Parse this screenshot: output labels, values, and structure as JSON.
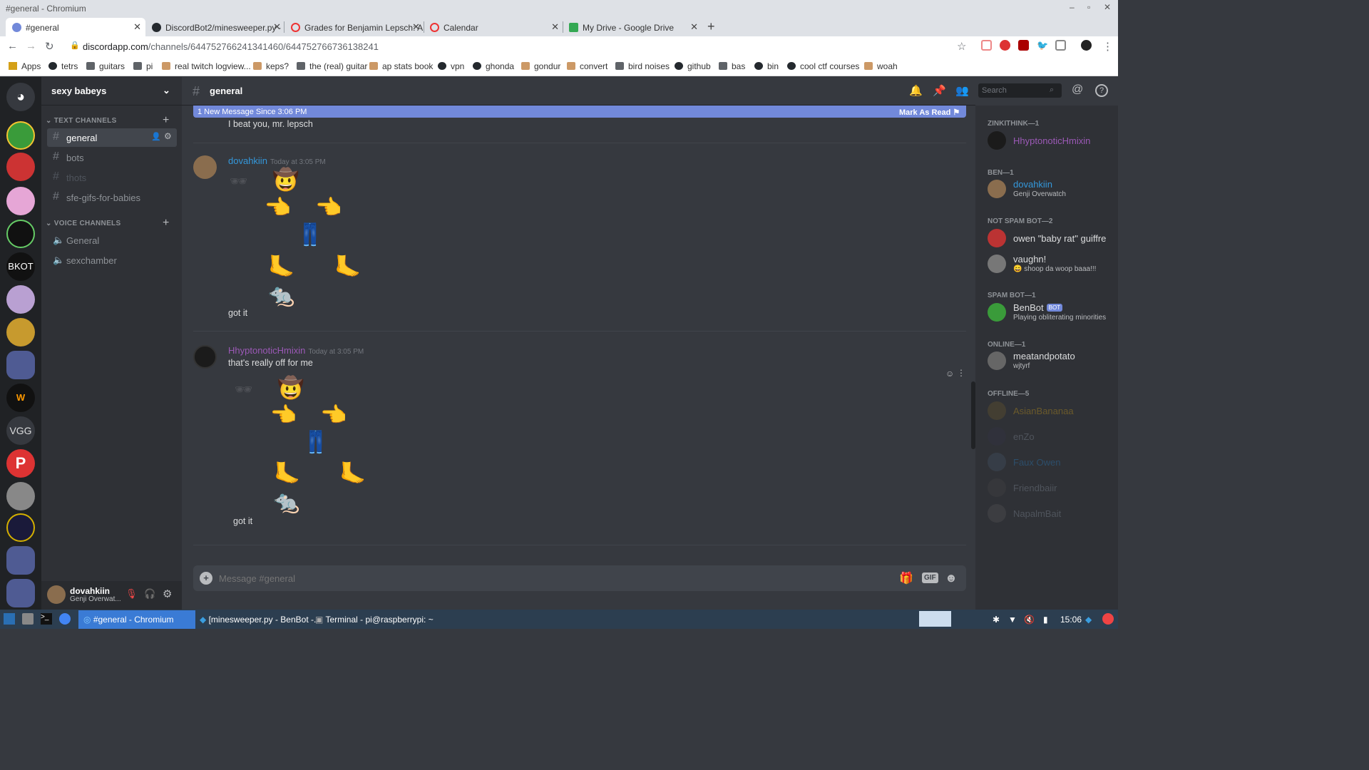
{
  "window": {
    "title": "#general - Chromium"
  },
  "tabs": [
    {
      "label": "#general",
      "color": "#7289da"
    },
    {
      "label": "DiscordBot2/minesweeper.py · ",
      "color": "#24292e"
    },
    {
      "label": "Grades for Benjamin Lepsch: A",
      "color": "#e33"
    },
    {
      "label": "Calendar",
      "color": "#e33"
    },
    {
      "label": "My Drive - Google Drive",
      "color": "#34a853"
    }
  ],
  "url": {
    "host": "discordapp.com",
    "path": "/channels/644752766241341460/644752766736138241"
  },
  "bookmarks": [
    {
      "label": "Apps",
      "icon": "apps-icon"
    },
    {
      "label": "tetrs",
      "icon": "globe-icon"
    },
    {
      "label": "guitars",
      "icon": "folder-icon"
    },
    {
      "label": "pi",
      "icon": "folder-icon"
    },
    {
      "label": "real twitch logview...",
      "icon": "bookmark-icon"
    },
    {
      "label": "keps?",
      "icon": "bookmark-icon"
    },
    {
      "label": "the (real) guitar",
      "icon": "folder-icon"
    },
    {
      "label": "ap stats book",
      "icon": "bookmark-icon"
    },
    {
      "label": "vpn",
      "icon": "github-icon"
    },
    {
      "label": "ghonda",
      "icon": "globe-icon"
    },
    {
      "label": "gondur",
      "icon": "bookmark-icon"
    },
    {
      "label": "convert",
      "icon": "bookmark-icon"
    },
    {
      "label": "bird noises",
      "icon": "folder-icon"
    },
    {
      "label": "github",
      "icon": "github-icon"
    },
    {
      "label": "bas",
      "icon": "folder-icon"
    },
    {
      "label": "bin",
      "icon": "globe-icon"
    },
    {
      "label": "cool ctf courses",
      "icon": "globe-icon"
    },
    {
      "label": "woah",
      "icon": "bookmark-icon"
    }
  ],
  "server": {
    "name": "sexy babeys",
    "vgg": "VGG"
  },
  "sidebar": {
    "text_cat": "TEXT CHANNELS",
    "text_channels": [
      "general",
      "bots",
      "thots",
      "sfe-gifs-for-babies"
    ],
    "voice_cat": "VOICE CHANNELS",
    "voice_channels": [
      "General",
      "sexchamber"
    ]
  },
  "user": {
    "name": "dovahkiin",
    "status": "Genji Overwat..."
  },
  "chat": {
    "channel": "general",
    "new_banner": "1 New Message Since 3:06 PM",
    "mark_read": "Mark As Read",
    "prev_text": "I beat you, mr. lepsch",
    "messages": [
      {
        "author": "dovahkiin",
        "time": "Today at 3:05 PM",
        "color": "#3498db",
        "lines": [],
        "caption": "got it"
      },
      {
        "author": "HhyptonoticHmixin",
        "time": "Today at 3:05 PM",
        "color": "#9b59b6",
        "lines": [
          "that's really off for me"
        ],
        "caption": "got it"
      }
    ],
    "placeholder": "Message #general"
  },
  "emoji": {
    "cowboy": "🤠",
    "left": "👉",
    "right": "👈",
    "jeans": "👖",
    "foot": "🦶",
    "rat": "🐀",
    "sunglasses": "🕶"
  },
  "members": {
    "search_placeholder": "Search",
    "groups": [
      {
        "title": "ZINKITHINK—1",
        "items": [
          {
            "name": "HhyptonoticHmixin",
            "color": "#9b59b6",
            "sub": ""
          }
        ]
      },
      {
        "title": "BEN—1",
        "items": [
          {
            "name": "dovahkiin",
            "color": "#3498db",
            "sub": "Genji Overwatch"
          }
        ]
      },
      {
        "title": "NOT SPAM BOT—2",
        "items": [
          {
            "name": "owen \"baby rat\" guiffre",
            "color": "#dcddde",
            "sub": ""
          },
          {
            "name": "vaughn!",
            "color": "#dcddde",
            "sub": "😄 shoop da woop baaa!!!"
          }
        ]
      },
      {
        "title": "SPAM BOT—1",
        "items": [
          {
            "name": "BenBot",
            "color": "#dcddde",
            "sub": "Playing obliterating minorities",
            "badge": "BOT"
          }
        ]
      },
      {
        "title": "ONLINE—1",
        "items": [
          {
            "name": "meatandpotato",
            "color": "#dcddde",
            "sub": "wjtyrf"
          }
        ]
      },
      {
        "title": "OFFLINE—5",
        "items": [
          {
            "name": "AsianBananaa",
            "color": "#6b5a2b",
            "sub": ""
          },
          {
            "name": "enZo",
            "color": "#4f545c",
            "sub": ""
          },
          {
            "name": "Faux Owen",
            "color": "#2c4e6b",
            "sub": ""
          },
          {
            "name": "Friendbaiir",
            "color": "#4f545c",
            "sub": ""
          },
          {
            "name": "NapalmBait",
            "color": "#4f545c",
            "sub": ""
          }
        ]
      }
    ]
  },
  "taskbar": {
    "items": [
      "#general - Chromium",
      "[minesweeper.py - BenBot -...",
      "Terminal - pi@raspberrypi: ~"
    ],
    "clock": "15:06"
  }
}
